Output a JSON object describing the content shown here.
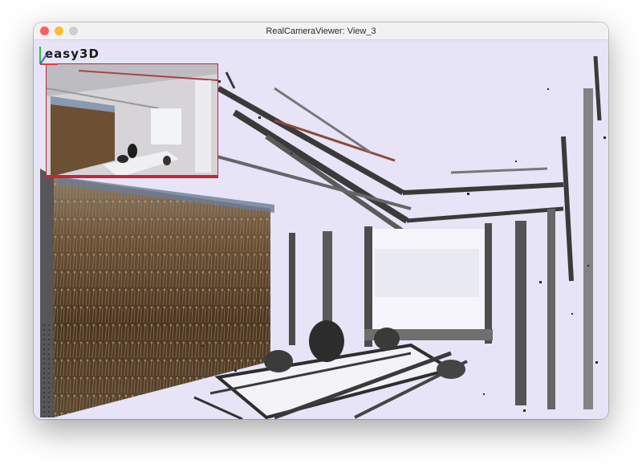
{
  "window": {
    "title": "RealCameraViewer: View_3",
    "controls": {
      "close_color": "#ff5f57",
      "minimize_color": "#febc2e",
      "zoom_color": "#cfcdd0"
    }
  },
  "viewer": {
    "logo_text": "easy3D",
    "background_color": "#e6e4f6",
    "inset_border_color": "#c0283a"
  },
  "axis_gizmo": {
    "x_color": "#e53b3b",
    "y_color": "#2fbf4a",
    "z_color": "#3a5be0"
  }
}
